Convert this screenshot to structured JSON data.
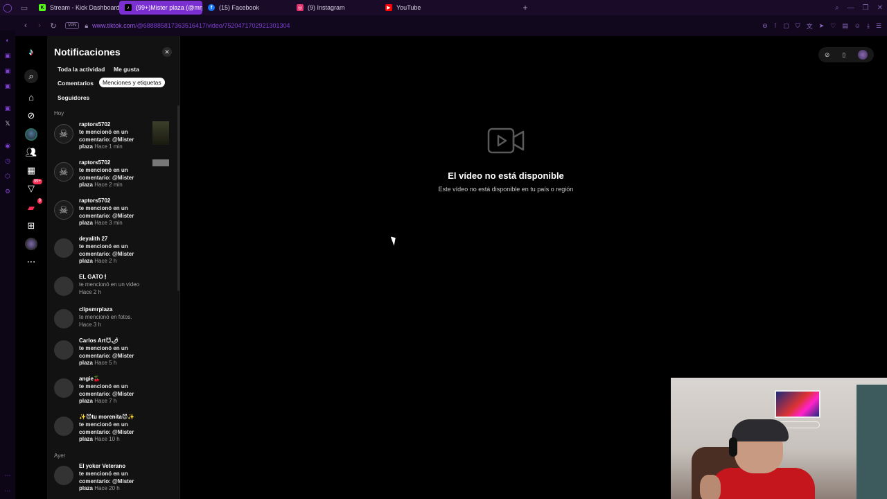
{
  "browser": {
    "tabs": [
      {
        "label": "Stream - Kick Dashboard",
        "icon": "kick-icon",
        "color": "#53fc18",
        "active": false
      },
      {
        "label": "(99+)Mister plaza (@mrp",
        "icon": "tiktok-icon",
        "color": "#000000",
        "active": true
      },
      {
        "label": "(15) Facebook",
        "icon": "facebook-icon",
        "color": "#1877f2",
        "active": false
      },
      {
        "label": "(9) Instagram",
        "icon": "instagram-icon",
        "color": "#e1306c",
        "active": false
      },
      {
        "label": "YouTube",
        "icon": "youtube-icon",
        "color": "#ff0000",
        "active": false
      }
    ],
    "vpn_label": "VPN",
    "url_host": "www.tiktok.com",
    "url_path": "/@68888581736351641​7/video/7520471702921301304"
  },
  "tiktok": {
    "notifications": {
      "title": "Notificaciones",
      "filters": [
        "Toda la actividad",
        "Me gusta",
        "Comentarios",
        "Menciones y etiquetas",
        "Seguidores"
      ],
      "selected_filter": "Menciones y etiquetas",
      "sections": {
        "today": "Hoy",
        "yesterday": "Ayer"
      },
      "items": [
        {
          "name": "raptors5702",
          "text": "te mencionó en un comentario: @Mister plaza",
          "time": "Hace 1 min"
        },
        {
          "name": "raptors5702",
          "text": "te mencionó en un comentario: @Mister plaza",
          "time": "Hace 2 min"
        },
        {
          "name": "raptors5702",
          "text": "te mencionó en un comentario: @Mister plaza",
          "time": "Hace 3 min"
        },
        {
          "name": "deyalith 27",
          "text": "te mencionó en un comentario: @Mister plaza",
          "time": "Hace 2 h"
        },
        {
          "name": "EL GATO 🕯",
          "text": "te mencionó en un video",
          "time": "Hace 2 h"
        },
        {
          "name": "clipsmrplaza",
          "text": "te mencionó en fotos.",
          "time": "Hace 3 h"
        },
        {
          "name": "Carlos Art😈🌶",
          "text": "te mencionó en un comentario: @Mister plaza",
          "time": "Hace 5 h"
        },
        {
          "name": "angie🍒",
          "text": "te mencionó en un comentario: @Mister plaza",
          "time": "Hace 7 h"
        },
        {
          "name": "✨😈tu morenita😈✨",
          "text": "te mencionó en un comentario: @Mister plaza",
          "time": "Hace 10 h"
        },
        {
          "name": "El yoker Veterano",
          "text": "te mencionó en un comentario: @Mister plaza",
          "time": "Hace 20 h"
        }
      ]
    },
    "rail_badge": "99+",
    "rail_badge_2": "9",
    "video": {
      "title": "El vídeo no está disponible",
      "subtitle": "Este vídeo no está disponible en tu país o región"
    }
  }
}
